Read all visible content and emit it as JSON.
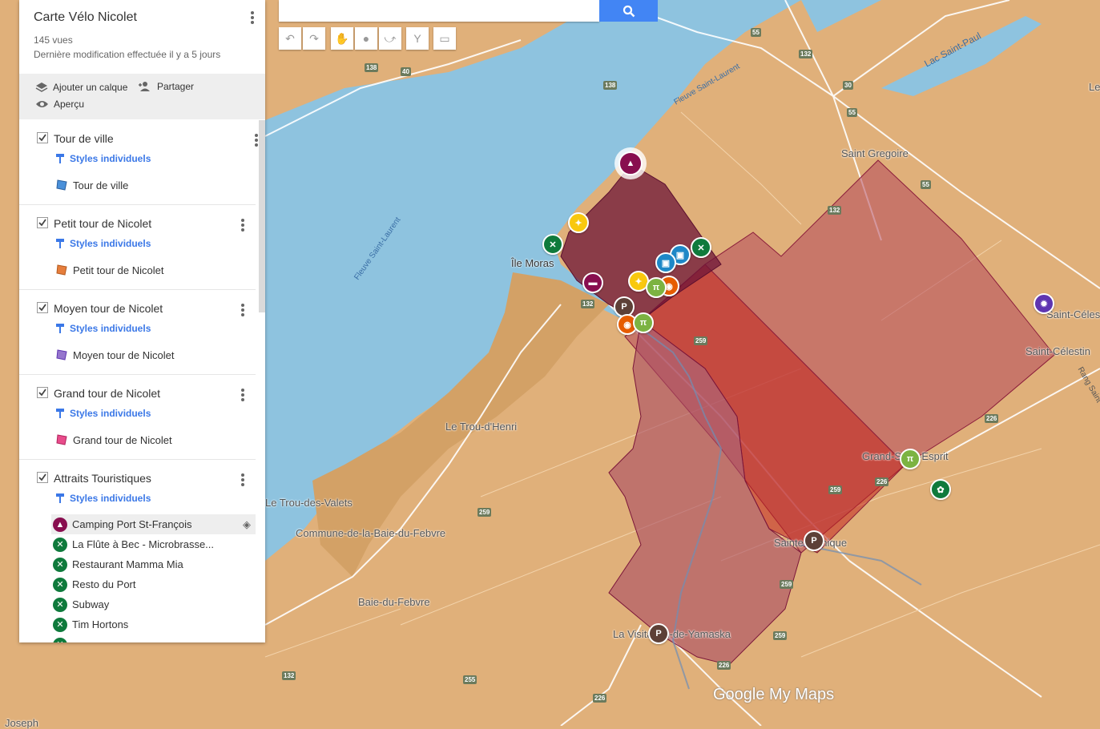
{
  "panel": {
    "title": "Carte Vélo Nicolet",
    "views": "145 vues",
    "modified": "Dernière modification effectuée il y a 5 jours",
    "add_layer": "Ajouter un calque",
    "share": "Partager",
    "preview": "Aperçu"
  },
  "layers": [
    {
      "name": "Tour de ville",
      "styles": "Styles individuels",
      "item": "Tour de ville",
      "color": "#4a90d9"
    },
    {
      "name": "Petit tour de Nicolet",
      "styles": "Styles individuels",
      "item": "Petit tour de Nicolet",
      "color": "#e67e3c"
    },
    {
      "name": "Moyen tour de Nicolet",
      "styles": "Styles individuels",
      "item": "Moyen tour de Nicolet",
      "color": "#9575cd"
    },
    {
      "name": "Grand tour de Nicolet",
      "styles": "Styles individuels",
      "item": "Grand tour de Nicolet",
      "color": "#e84c8b"
    }
  ],
  "attractions": {
    "name": "Attraits Touristiques",
    "styles": "Styles individuels",
    "items": [
      {
        "label": "Camping Port St-François",
        "icon": "camping-icon",
        "color": "#880e4f"
      },
      {
        "label": "La Flûte à Bec - Microbrasse...",
        "icon": "restaurant-icon",
        "color": "#0f7a3c"
      },
      {
        "label": "Restaurant Mamma Mia",
        "icon": "restaurant-icon",
        "color": "#0f7a3c"
      },
      {
        "label": "Resto du Port",
        "icon": "restaurant-icon",
        "color": "#0f7a3c"
      },
      {
        "label": "Subway",
        "icon": "restaurant-icon",
        "color": "#0f7a3c"
      },
      {
        "label": "Tim Hortons",
        "icon": "restaurant-icon",
        "color": "#0f7a3c"
      }
    ]
  },
  "map": {
    "places": {
      "ile_moras": "Île Moras",
      "saint_gregoire": "Saint Gregoire",
      "trou_henri": "Le Trou-d'Henri",
      "trou_valets": "Le Trou-des-Valets",
      "commune": "Commune-de-la-Baie-du-Febvre",
      "baie_febvre": "Baie-du-Febvre",
      "saint_celestin": "Saint-Célestin",
      "saint_celes_partial": "Saint-Céles",
      "grand_esprit": "Grand-Saint-Esprit",
      "sainte_monique": "Sainte-Monique",
      "visitation": "La Visitation-de-Yamaska",
      "joseph": "Joseph",
      "le_partial": "Le"
    },
    "water": {
      "fleuve1": "Fleuve Saint-Laurent",
      "fleuve2": "Fleuve Saint-Laurent",
      "lac": "Lac Saint-Paul",
      "rang": "Rang Saint"
    },
    "roads": [
      "55",
      "132",
      "30",
      "55",
      "138",
      "40",
      "138",
      "132",
      "55",
      "132",
      "226",
      "259",
      "259",
      "259",
      "259",
      "226",
      "255",
      "226",
      "132",
      "259",
      "226"
    ],
    "brand": "Google My Maps"
  }
}
